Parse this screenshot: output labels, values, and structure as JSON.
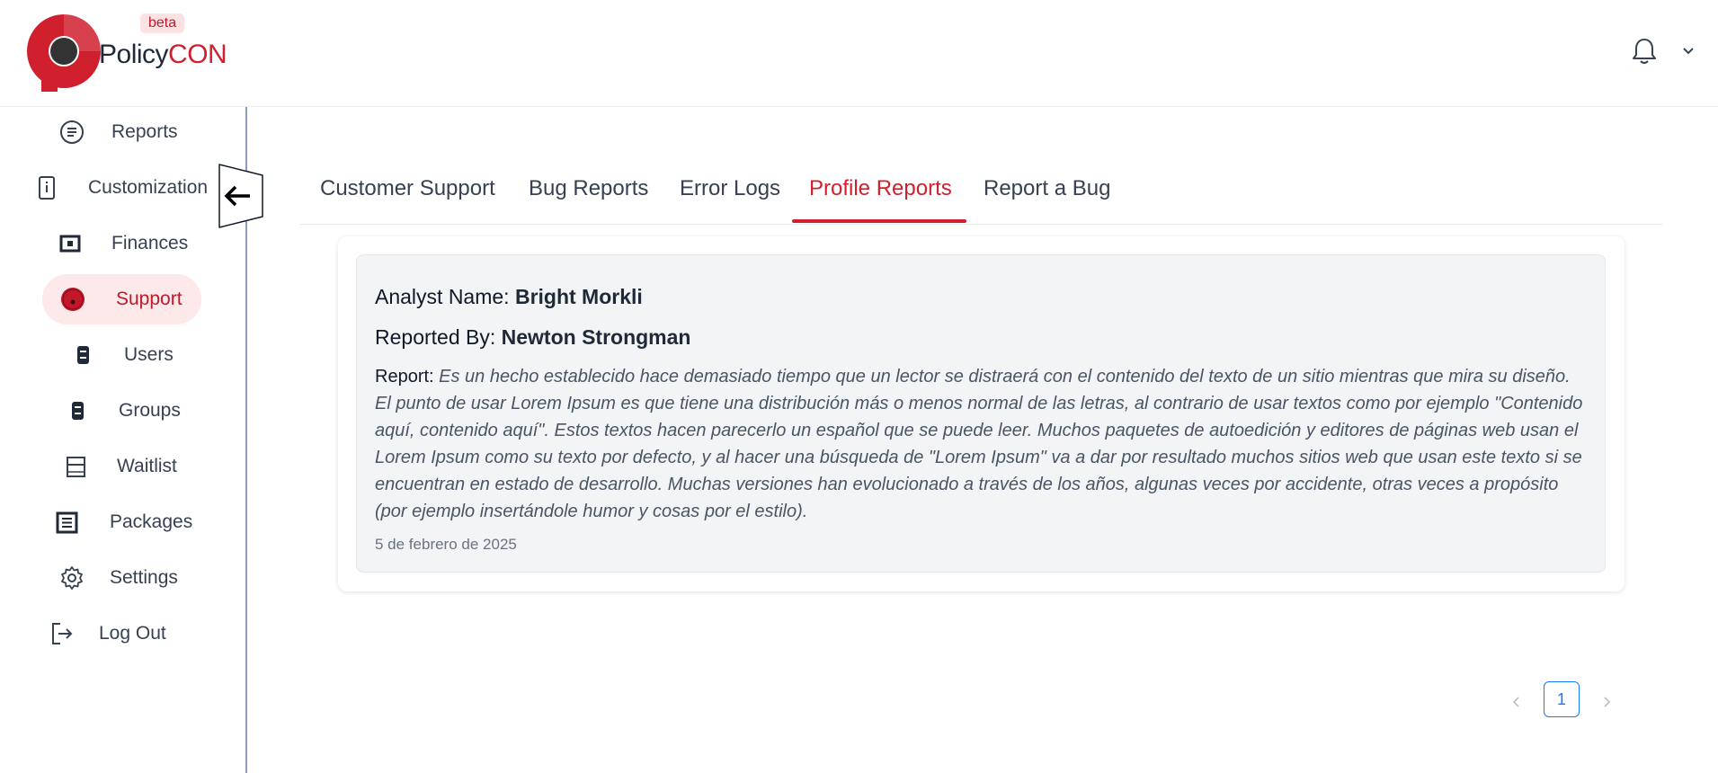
{
  "brand": {
    "name_part1": "Policy",
    "name_part2": "CON",
    "badge": "beta",
    "colors": {
      "brand_red": "#d0202e",
      "dark": "#333333"
    }
  },
  "header": {
    "notification_icon": "bell-icon",
    "menu_icon": "chevron-down-icon"
  },
  "sidebar": {
    "items": [
      {
        "label": "Reports",
        "icon": "list-circle-icon"
      },
      {
        "label": "Customization",
        "icon": "phone-device-icon"
      },
      {
        "label": "Finances",
        "icon": "finance-square-icon"
      },
      {
        "label": "Support",
        "icon": "support-dot-icon",
        "active": true
      },
      {
        "label": "Users",
        "icon": "users-block-icon"
      },
      {
        "label": "Groups",
        "icon": "groups-block-icon"
      },
      {
        "label": "Waitlist",
        "icon": "waitlist-panel-icon"
      },
      {
        "label": "Packages",
        "icon": "packages-list-icon"
      },
      {
        "label": "Settings",
        "icon": "gear-icon"
      },
      {
        "label": "Log Out",
        "icon": "logout-icon"
      }
    ],
    "collapse_icon": "arrow-left-icon"
  },
  "tabs": [
    {
      "label": "Customer Support"
    },
    {
      "label": "Bug Reports"
    },
    {
      "label": "Error Logs"
    },
    {
      "label": "Profile Reports",
      "active": true
    },
    {
      "label": "Report a Bug"
    }
  ],
  "report_card": {
    "analyst_label": "Analyst Name:",
    "analyst_name": "Bright Morkli",
    "reported_by_label": "Reported By:",
    "reported_by_name": "Newton Strongman",
    "report_label": "Report:",
    "report_text": "Es un hecho establecido hace demasiado tiempo que un lector se distraerá con el contenido del texto de un sitio mientras que mira su diseño. El punto de usar Lorem Ipsum es que tiene una distribución más o menos normal de las letras, al contrario de usar textos como por ejemplo \"Contenido aquí, contenido aquí\". Estos textos hacen parecerlo un español que se puede leer. Muchos paquetes de autoedición y editores de páginas web usan el Lorem Ipsum como su texto por defecto, y al hacer una búsqueda de \"Lorem Ipsum\" va a dar por resultado muchos sitios web que usan este texto si se encuentran en estado de desarrollo. Muchas versiones han evolucionado a través de los años, algunas veces por accidente, otras veces a propósito (por ejemplo insertándole humor y cosas por el estilo).",
    "date": "5 de febrero de 2025"
  },
  "pagination": {
    "current_page": "1",
    "prev_icon": "chevron-left-icon",
    "next_icon": "chevron-right-icon"
  }
}
